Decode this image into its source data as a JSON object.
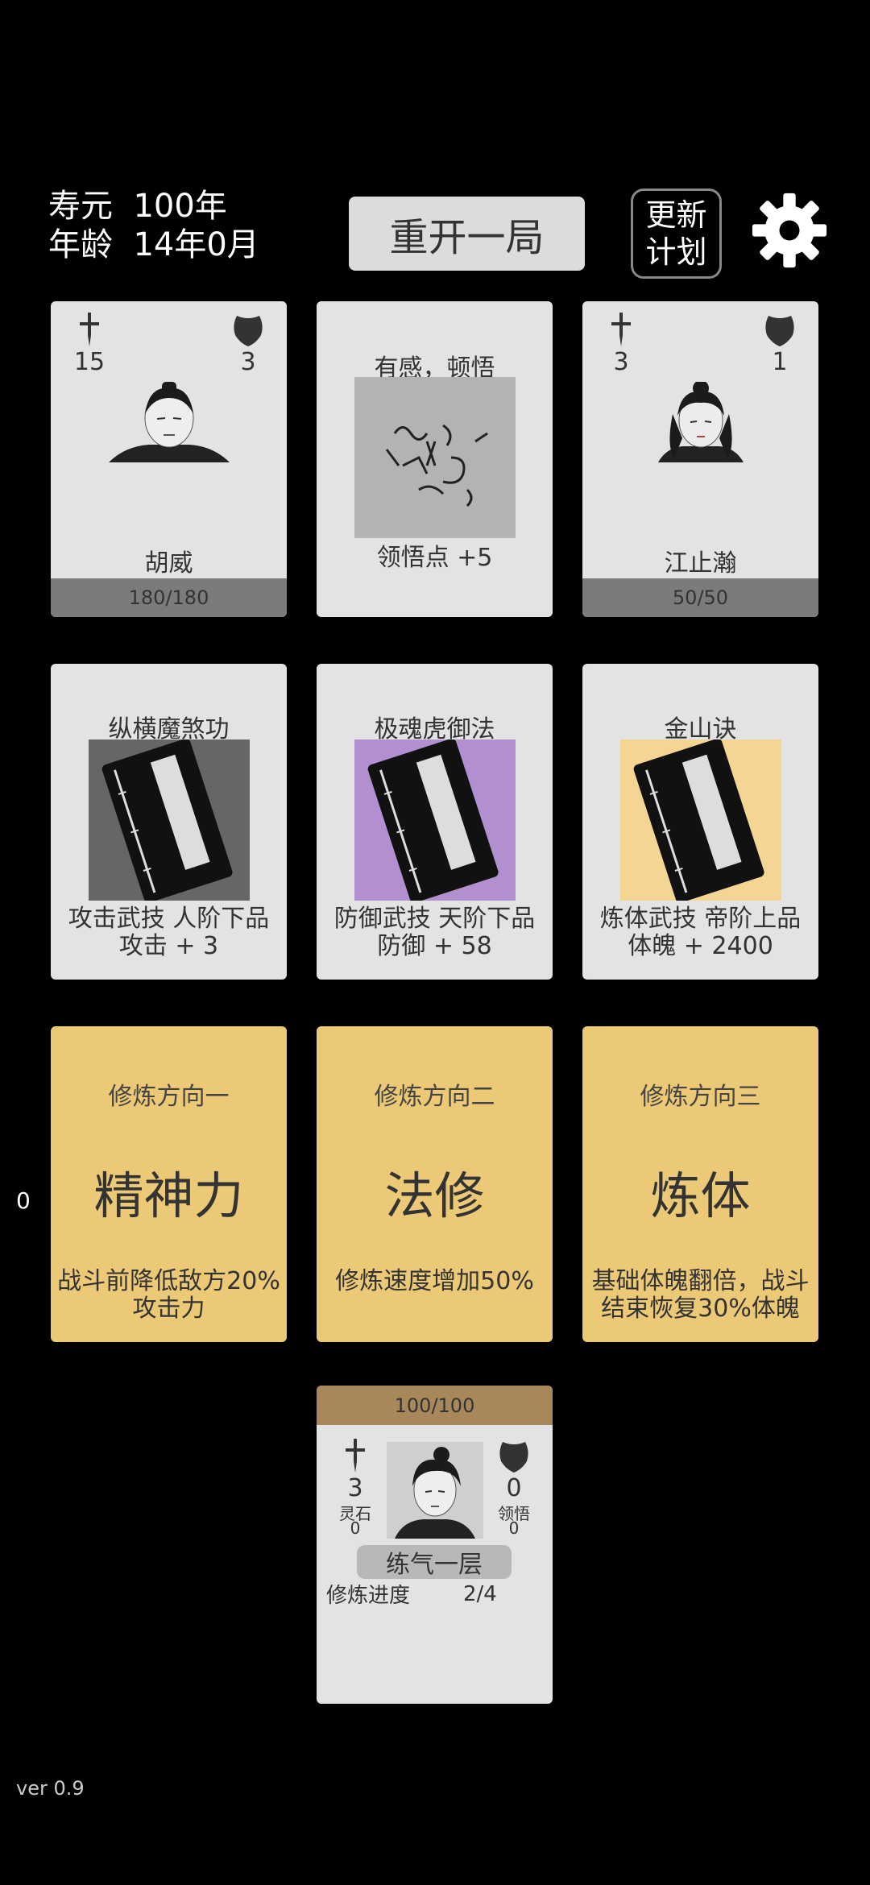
{
  "header": {
    "lifespan_label": "寿元",
    "lifespan_value": "100年",
    "age_label": "年龄",
    "age_value": "14年0月",
    "restart_label": "重开一局",
    "update_label": "更新\n计划"
  },
  "row1": [
    {
      "type": "enemy",
      "attack": "15",
      "defense": "3",
      "name": "胡威",
      "hp": "180/180"
    },
    {
      "type": "event",
      "title": "有感，顿悟",
      "reward": "领悟点  +5"
    },
    {
      "type": "enemy",
      "attack": "3",
      "defense": "1",
      "name": "江止瀚",
      "hp": "50/50"
    }
  ],
  "row2": [
    {
      "title": "纵横魔煞功",
      "line1": "攻击武技  人阶下品",
      "line2": "攻击 + 3",
      "color": "#666666"
    },
    {
      "title": "极魂虎御法",
      "line1": "防御武技  天阶下品",
      "line2": "防御 + 58",
      "color": "#b28fcf"
    },
    {
      "title": "金山诀",
      "line1": "炼体武技  帝阶上品",
      "line2": "体魄 + 2400",
      "color": "#f5d593"
    }
  ],
  "row3": [
    {
      "title": "修炼方向一",
      "name": "精神力",
      "desc": "战斗前降低敌方20%\n攻击力"
    },
    {
      "title": "修炼方向二",
      "name": "法修",
      "desc": "修炼速度增加50%"
    },
    {
      "title": "修炼方向三",
      "name": "炼体",
      "desc": "基础体魄翻倍，战斗\n结束恢复30%体魄"
    }
  ],
  "side_counter": "0",
  "player": {
    "hp": "100/100",
    "attack": "3",
    "spirit_stone_label": "灵石",
    "spirit_stone": "0",
    "defense": "0",
    "insight_label": "领悟",
    "insight": "0",
    "realm": "练气一层",
    "progress_label": "修炼进度",
    "progress": "2/4"
  },
  "version": "ver 0.9",
  "icons": {
    "attack": "sword-icon",
    "defense": "shield-icon",
    "settings": "gear-icon",
    "book": "book-icon"
  }
}
